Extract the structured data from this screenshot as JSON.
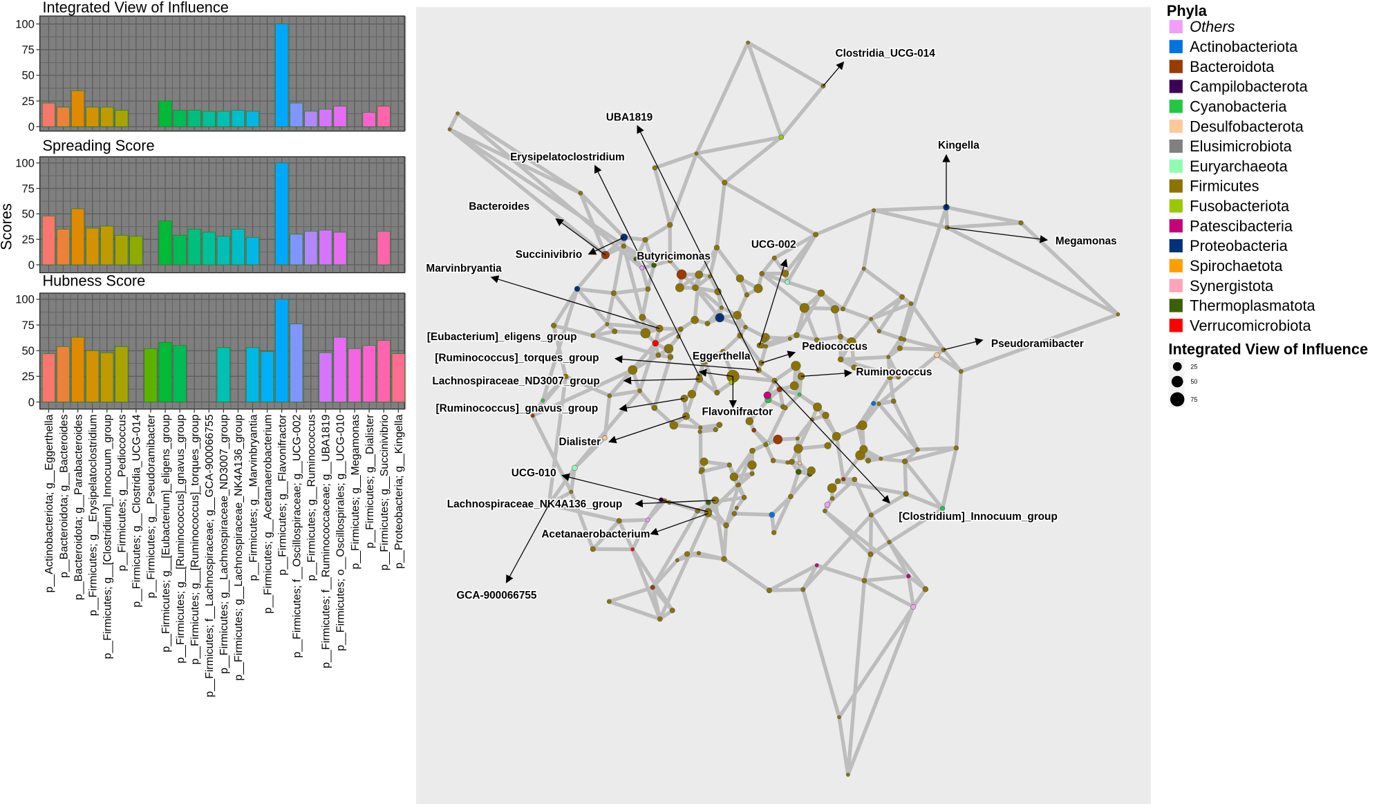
{
  "bar_panel": {
    "y_axis_label": "Scores",
    "colors": [
      "#F8766D",
      "#EC8239",
      "#E18A00",
      "#D39200",
      "#C09B00",
      "#A9A300",
      "#8FAA00",
      "#5BB300",
      "#00BA38",
      "#00BC56",
      "#00BF7D",
      "#00C19A",
      "#00C0B5",
      "#00BEC9",
      "#00B8E3",
      "#00B0F6",
      "#00A9FF",
      "#7F96FF",
      "#B385FF",
      "#D575FE",
      "#E76BF3",
      "#F564E3",
      "#FD61D1",
      "#FF65AC",
      "#FF6C91"
    ],
    "panel_background": "#7f7f7f",
    "grid_color": "#5c5c5c"
  },
  "chart_data": [
    {
      "type": "bar",
      "title": "Integrated View of Influence",
      "ylabel": "Scores",
      "ylim": [
        0,
        100
      ],
      "yticks": [
        "0",
        "25",
        "50",
        "75",
        "100"
      ],
      "grid": true,
      "categories": [
        "p__Actinobacteriota; g__Eggerthella",
        "p__Bacteroidota; g__Bacteroides",
        "p__Bacteroidota; g__Parabacteroides",
        "p__Firmicutes; g__Erysipelatoclostridium",
        "p__Firmicutes; g__[Clostridium]_Innocuum_group",
        "p__Firmicutes; g__Pediococcus",
        "p__Firmicutes; g__Clostridia_UCG-014",
        "p__Firmicutes; g__Pseudoramibacter",
        "p__Firmicutes; g__[Eubacterium]_eligens_group",
        "p__Firmicutes; g__[Ruminococcus]_gnavus_group",
        "p__Firmicutes; g__[Ruminococcus]_torques_group",
        "p__Firmicutes; f__Lachnospiraceae; g__GCA-900066755",
        "p__Firmicutes; g__Lachnospiraceae_ND3007_group",
        "p__Firmicutes; g__Lachnospiraceae_NK4A136_group",
        "p__Firmicutes; g__Marvinbryantia",
        "p__Firmicutes; g__Acetanaerobacterium",
        "p__Firmicutes; g__Flavonifractor",
        "p__Firmicutes; f__Oscillospiraceae; g__UCG-002",
        "p__Firmicutes; g__Ruminococcus",
        "p__Firmicutes; f__Ruminococcaceae; g__UBA1819",
        "p__Firmicutes; o__Oscillospirales; g__UCG-010",
        "p__Firmicutes; g__Megamonas",
        "p__Firmicutes; g__Dialister",
        "p__Firmicutes; g__Succinivibrio",
        "p__Proteobacteria; g__Kingella"
      ],
      "values": [
        23,
        19,
        35,
        19,
        19,
        16,
        null,
        null,
        25,
        16,
        16,
        15,
        15,
        16,
        15,
        null,
        100,
        23,
        15,
        17,
        20,
        null,
        14,
        20,
        null
      ]
    },
    {
      "type": "bar",
      "title": "Spreading Score",
      "ylim": [
        0,
        100
      ],
      "yticks": [
        "0",
        "25",
        "50",
        "75",
        "100"
      ],
      "grid": true,
      "values": [
        48,
        35,
        55,
        36,
        38,
        29,
        28,
        null,
        43,
        29,
        35,
        32,
        28,
        35,
        27,
        null,
        100,
        30,
        33,
        34,
        32,
        null,
        null,
        33,
        null
      ]
    },
    {
      "type": "bar",
      "title": "Hubness Score",
      "ylim": [
        0,
        100
      ],
      "yticks": [
        "0",
        "25",
        "50",
        "75",
        "100"
      ],
      "grid": true,
      "values": [
        47,
        54,
        63,
        50,
        48,
        54,
        null,
        52,
        58,
        55,
        null,
        null,
        53,
        null,
        53,
        49,
        100,
        76,
        null,
        48,
        63,
        52,
        55,
        60,
        47
      ]
    }
  ],
  "network": {
    "background": "#ebebeb",
    "edge_color": "#bdbdbd",
    "annotations": [
      {
        "label": "Clostridia_UCG-014",
        "phylum": "Firmicutes"
      },
      {
        "label": "UBA1819",
        "phylum": "Firmicutes"
      },
      {
        "label": "Kingella",
        "phylum": "Proteobacteria"
      },
      {
        "label": "Erysipelatoclostridium",
        "phylum": "Firmicutes"
      },
      {
        "label": "Bacteroides",
        "phylum": "Bacteroidota"
      },
      {
        "label": "Megamonas",
        "phylum": "Firmicutes"
      },
      {
        "label": "UCG-002",
        "phylum": "Firmicutes"
      },
      {
        "label": "Succinivibrio",
        "phylum": "Proteobacteria"
      },
      {
        "label": "Butyricimonas",
        "phylum": "Bacteroidota"
      },
      {
        "label": "Marvinbryantia",
        "phylum": "Firmicutes"
      },
      {
        "label": "Pediococcus",
        "phylum": "Firmicutes"
      },
      {
        "label": "Pseudoramibacter",
        "phylum": "Firmicutes"
      },
      {
        "label": "[Eubacterium]_eligens_group",
        "phylum": "Firmicutes"
      },
      {
        "label": "[Ruminococcus]_torques_group",
        "phylum": "Firmicutes"
      },
      {
        "label": "Eggerthella",
        "phylum": "Actinobacteriota"
      },
      {
        "label": "Ruminococcus",
        "phylum": "Firmicutes"
      },
      {
        "label": "Lachnospiraceae_ND3007_group",
        "phylum": "Firmicutes"
      },
      {
        "label": "[Ruminococcus]_gnavus_group",
        "phylum": "Firmicutes"
      },
      {
        "label": "Flavonifractor",
        "phylum": "Firmicutes"
      },
      {
        "label": "Dialister",
        "phylum": "Firmicutes"
      },
      {
        "label": "UCG-010",
        "phylum": "Firmicutes"
      },
      {
        "label": "Lachnospiraceae_NK4A136_group",
        "phylum": "Firmicutes"
      },
      {
        "label": "[Clostridium]_Innocuum_group",
        "phylum": "Firmicutes"
      },
      {
        "label": "Acetanaerobacterium",
        "phylum": "Firmicutes"
      },
      {
        "label": "GCA-900066755",
        "phylum": "Firmicutes"
      }
    ]
  },
  "legend": {
    "title": "Phyla",
    "items": [
      {
        "label": "Others",
        "color": "#F0A0F8",
        "italic": true
      },
      {
        "label": "Actinobacteriota",
        "color": "#0073E0"
      },
      {
        "label": "Bacteroidota",
        "color": "#9A3B00"
      },
      {
        "label": "Campilobacterota",
        "color": "#3E0056"
      },
      {
        "label": "Cyanobacteria",
        "color": "#22C843"
      },
      {
        "label": "Desulfobacterota",
        "color": "#FFC899"
      },
      {
        "label": "Elusimicrobiota",
        "color": "#808080"
      },
      {
        "label": "Euryarchaeota",
        "color": "#8FFCB0"
      },
      {
        "label": "Firmicutes",
        "color": "#8C7300"
      },
      {
        "label": "Fusobacteriota",
        "color": "#9AC800"
      },
      {
        "label": "Patescibacteria",
        "color": "#C4007A"
      },
      {
        "label": "Proteobacteria",
        "color": "#00317A"
      },
      {
        "label": "Spirochaetota",
        "color": "#FF9E00"
      },
      {
        "label": "Synergistota",
        "color": "#FFA3B8"
      },
      {
        "label": "Thermoplasmatota",
        "color": "#3A6000"
      },
      {
        "label": "Verrucomicrobiota",
        "color": "#FF0000"
      }
    ],
    "size_title": "Integrated View of Influence",
    "size_items": [
      "25",
      "50",
      "75"
    ]
  }
}
